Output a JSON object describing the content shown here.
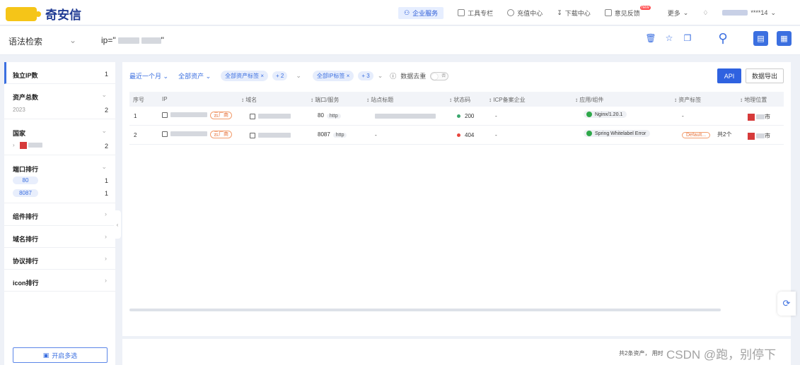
{
  "brand": {
    "name": "奇安信"
  },
  "topnav": {
    "enterprise": "企业服务",
    "tools": "工具专栏",
    "recharge": "充值中心",
    "download": "下载中心",
    "feedback": "意见反馈",
    "feedback_badge": "new",
    "more": "更多",
    "user_suffix": "****14"
  },
  "search": {
    "type": "语法检索",
    "query_prefix": "ip=\"",
    "query_suffix": "\""
  },
  "sidebar": {
    "unique_ip": {
      "label": "独立IP数",
      "count": "1"
    },
    "asset_total": {
      "label": "资产总数",
      "year": "2023",
      "count": "2"
    },
    "country": {
      "label": "国家",
      "count": "2"
    },
    "ports": {
      "label": "端口排行",
      "items": [
        {
          "port": "80",
          "count": "1"
        },
        {
          "port": "8087",
          "count": "1"
        }
      ]
    },
    "component": {
      "label": "组件排行"
    },
    "domain": {
      "label": "域名排行"
    },
    "protocol": {
      "label": "协议排行"
    },
    "icon": {
      "label": "icon排行"
    },
    "multi_select": "开启多选"
  },
  "filters": {
    "time": "最近一个月",
    "assets": "全部资产",
    "asset_tag": "全部资产标签",
    "asset_tag_more": "+ 2",
    "ip_tag": "全部IP标签",
    "ip_tag_more": "+ 3",
    "dedup": "数据去重",
    "toggle_off": "否",
    "api": "API",
    "export": "数据导出"
  },
  "table": {
    "headers": [
      "序号",
      "IP",
      "域名",
      "端口/服务",
      "站点标题",
      "状态码",
      "ICP备案企业",
      "应用/组件",
      "资产标签",
      "地理位置"
    ],
    "rows": [
      {
        "idx": "1",
        "cloud": "云厂商",
        "port": "80",
        "proto": "http",
        "status": "200",
        "status_color": "#3aa76d",
        "icp": "-",
        "component": "Nginx/1.20.1",
        "asset_tag": "-",
        "tag_count": "",
        "city": "市"
      },
      {
        "idx": "2",
        "cloud": "云厂商",
        "port": "8087",
        "proto": "http",
        "title": "-",
        "status": "404",
        "status_color": "#e8453c",
        "icp": "-",
        "component": "Spring Whitelabel Error",
        "asset_tag": "Default...",
        "tag_count": "共2个",
        "city": "市"
      }
    ]
  },
  "footer": {
    "summary": "共2条资产， 用时"
  },
  "watermark": "CSDN @跑，别停下"
}
